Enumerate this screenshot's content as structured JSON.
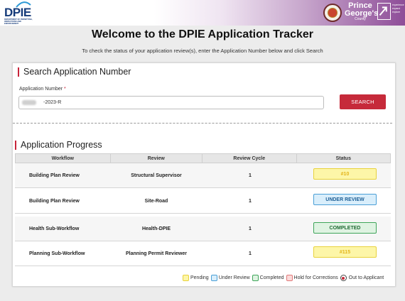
{
  "header": {
    "dpie_logo_text": "DPIE",
    "dpie_logo_subtext": "DEPARTMENT OF PERMITTING, INSPECTIONS AND ENFORCEMENT",
    "county_name_line1": "Prince",
    "county_name_line2": "George's",
    "county_name_line3": "County",
    "county_tagline": "experience expand explore"
  },
  "page": {
    "title": "Welcome to the DPIE Application Tracker",
    "subtitle": "To check the status of your application review(s), enter the Application Number below and click Search"
  },
  "search": {
    "section_title": "Search Application Number",
    "field_label": "Application Number",
    "required_mark": "*",
    "input_value": "-2023-R",
    "button_label": "SEARCH"
  },
  "progress": {
    "section_title": "Application Progress",
    "columns": [
      "Workflow",
      "Review",
      "Review Cycle",
      "Status"
    ],
    "rows": [
      {
        "workflow": "Building Plan Review",
        "review": "Structural Supervisor",
        "cycle": "1",
        "status": "#10",
        "status_type": "pending"
      },
      {
        "workflow": "Building Plan Review",
        "review": "Site-Road",
        "cycle": "1",
        "status": "UNDER REVIEW",
        "status_type": "under-review"
      },
      {
        "workflow": "Health Sub-Workflow",
        "review": "Health-DPIE",
        "cycle": "1",
        "status": "COMPLETED",
        "status_type": "completed"
      },
      {
        "workflow": "Planning Sub-Workflow",
        "review": "Planning Permit Reviewer",
        "cycle": "1",
        "status": "#115",
        "status_type": "pending"
      }
    ]
  },
  "legend": {
    "pending": "Pending",
    "under_review": "Under Review",
    "completed": "Completed",
    "hold": "Hold for Corrections",
    "out": "Out to Applicant"
  },
  "colors": {
    "accent_red": "#c62a3a",
    "pending_bg": "#fdf6a8",
    "pending_border": "#e8d23c",
    "pending_text": "#e3b41a",
    "review_bg": "#d9eefb",
    "review_border": "#4a9fd6",
    "review_text": "#1e5f96",
    "completed_bg": "#dff3e2",
    "completed_border": "#3fa55a",
    "completed_text": "#1f6a33",
    "hold_bg": "#fbdada",
    "hold_border": "#e07a7a"
  }
}
